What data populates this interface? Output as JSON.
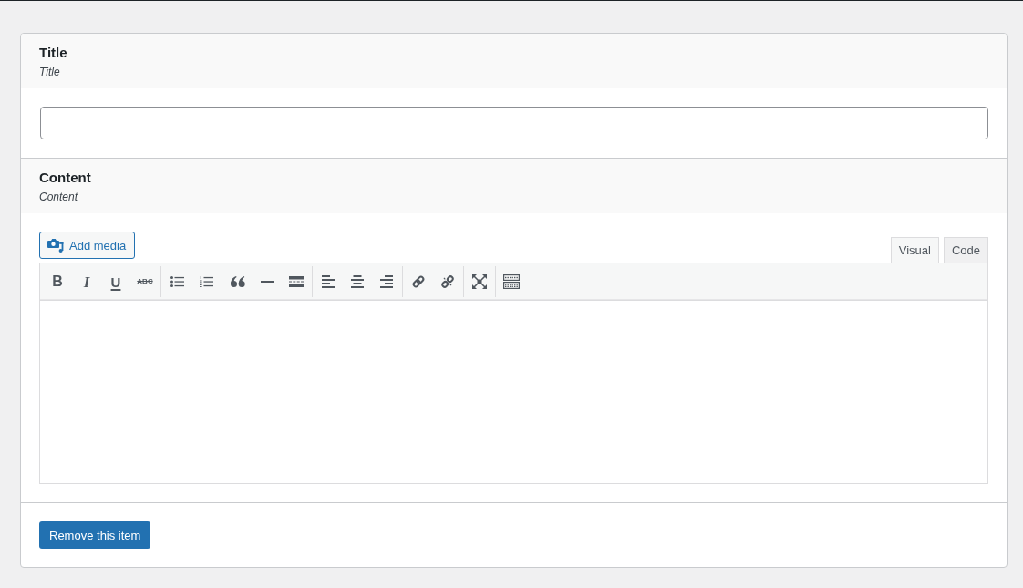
{
  "fields": [
    {
      "kind": "text",
      "label": "Title",
      "description": "Title"
    },
    {
      "kind": "editor",
      "label": "Content",
      "description": "Content",
      "add_media_button": "Add media",
      "tabs": [
        {
          "label": "Visual",
          "selected": true
        },
        {
          "label": "Code",
          "selected": false
        }
      ],
      "toolbar_groups": [
        {
          "buttons": [
            {
              "kind": "bold",
              "glyph": "B"
            },
            {
              "kind": "italic",
              "glyph": "I"
            },
            {
              "kind": "underline",
              "glyph": "U"
            },
            {
              "kind": "strikethrough",
              "glyph": "ABC"
            }
          ]
        },
        {
          "buttons": [
            {
              "kind": "bullet-list"
            },
            {
              "kind": "numbered-list"
            }
          ]
        },
        {
          "buttons": [
            {
              "kind": "blockquote"
            },
            {
              "kind": "horizontal-line"
            },
            {
              "kind": "read-more"
            }
          ]
        },
        {
          "buttons": [
            {
              "kind": "align-left"
            },
            {
              "kind": "align-center"
            },
            {
              "kind": "align-right"
            }
          ]
        },
        {
          "buttons": [
            {
              "kind": "link"
            },
            {
              "kind": "unlink"
            }
          ]
        },
        {
          "buttons": [
            {
              "kind": "fullscreen"
            }
          ]
        },
        {
          "buttons": [
            {
              "kind": "toolbar-toggle"
            }
          ]
        }
      ]
    }
  ],
  "remove_button": "Remove this item"
}
